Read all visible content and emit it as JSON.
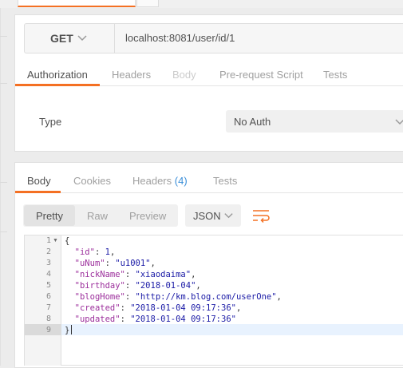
{
  "request": {
    "method": "GET",
    "url": "localhost:8081/user/id/1",
    "tabs": [
      {
        "label": "Authorization",
        "state": "active"
      },
      {
        "label": "Headers",
        "state": "normal"
      },
      {
        "label": "Body",
        "state": "disabled"
      },
      {
        "label": "Pre-request Script",
        "state": "normal"
      },
      {
        "label": "Tests",
        "state": "normal"
      }
    ],
    "auth": {
      "type_label": "Type",
      "selected": "No Auth"
    }
  },
  "response": {
    "tabs": [
      {
        "label": "Body",
        "state": "active"
      },
      {
        "label": "Cookies",
        "state": "normal"
      },
      {
        "label": "Headers",
        "badge": "(4)",
        "state": "normal"
      },
      {
        "label": "Tests",
        "state": "normal"
      }
    ],
    "view_modes": [
      "Pretty",
      "Raw",
      "Preview"
    ],
    "active_view": "Pretty",
    "format": "JSON",
    "line_numbers": [
      "1",
      "2",
      "3",
      "4",
      "5",
      "6",
      "7",
      "8",
      "9"
    ],
    "fields": [
      {
        "key": "\"id\"",
        "value": "1",
        "is_string": false
      },
      {
        "key": "\"uNum\"",
        "value": "\"u1001\"",
        "is_string": true
      },
      {
        "key": "\"nickName\"",
        "value": "\"xiaodaima\"",
        "is_string": true
      },
      {
        "key": "\"birthday\"",
        "value": "\"2018-01-04\"",
        "is_string": true
      },
      {
        "key": "\"blogHome\"",
        "value": "\"http://km.blog.com/userOne\"",
        "is_string": true
      },
      {
        "key": "\"created\"",
        "value": "\"2018-01-04 09:17:36\"",
        "is_string": true
      },
      {
        "key": "\"updated\"",
        "value": "\"2018-01-04 09:17:36\"",
        "is_string": true
      }
    ],
    "open_brace": "{",
    "close_brace": "}"
  },
  "icons": {
    "method_dropdown": "chevron-down-icon",
    "auth_dropdown": "chevron-down-icon",
    "format_dropdown": "chevron-down-icon",
    "wrap": "wrap-lines-icon",
    "fold": "fold-arrow-icon"
  },
  "colors": {
    "accent": "#f47023",
    "badge": "#3b8fd9",
    "current_line": "#e8f2fe"
  }
}
